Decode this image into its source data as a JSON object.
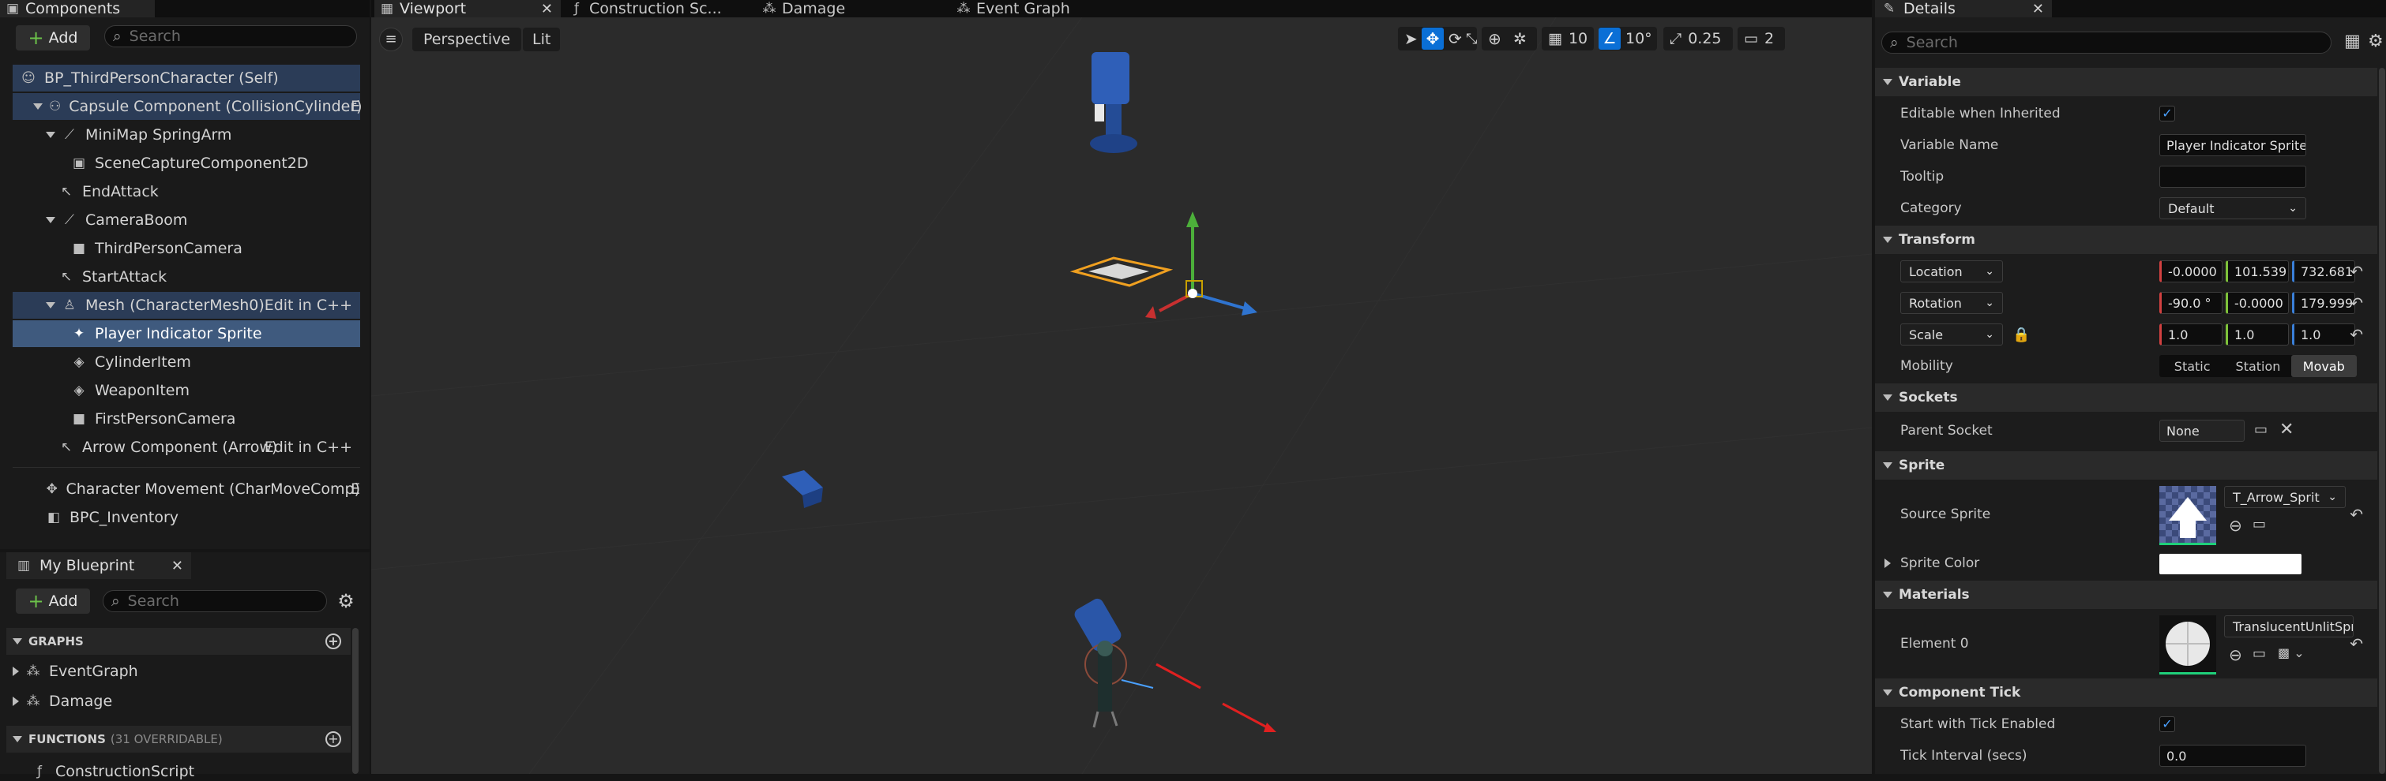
{
  "tabs": {
    "components": "Components",
    "viewport": "Viewport",
    "construction": "Construction Sc...",
    "damage": "Damage",
    "event_graph": "Event Graph",
    "details": "Details"
  },
  "components": {
    "add_label": "Add",
    "search_placeholder": "Search",
    "items": [
      {
        "label": "BP_ThirdPersonCharacter (Self)",
        "icon": "person-icon"
      },
      {
        "label": "Capsule Component (CollisionCylinder)",
        "icon": "capsule-icon",
        "suffix": "E"
      },
      {
        "label": "MiniMap SpringArm",
        "icon": "springarm-icon"
      },
      {
        "label": "SceneCaptureComponent2D",
        "icon": "scene-capture-icon"
      },
      {
        "label": "EndAttack",
        "icon": "arrow-icon"
      },
      {
        "label": "CameraBoom",
        "icon": "springarm-icon"
      },
      {
        "label": "ThirdPersonCamera",
        "icon": "camera-icon"
      },
      {
        "label": "StartAttack",
        "icon": "arrow-icon"
      },
      {
        "label": "Mesh (CharacterMesh0)",
        "icon": "skeletal-mesh-icon",
        "edit": "Edit in C++"
      },
      {
        "label": "Player Indicator Sprite",
        "icon": "sprite-icon"
      },
      {
        "label": "CylinderItem",
        "icon": "static-mesh-icon"
      },
      {
        "label": "WeaponItem",
        "icon": "static-mesh-icon"
      },
      {
        "label": "FirstPersonCamera",
        "icon": "camera-icon"
      },
      {
        "label": "Arrow Component (Arrow)",
        "icon": "arrow-icon",
        "edit": "Edit in C++"
      },
      {
        "label": "Character Movement (CharMoveComp)",
        "icon": "movement-icon",
        "suffix": "E"
      },
      {
        "label": "BPC_Inventory",
        "icon": "actor-component-icon"
      }
    ]
  },
  "my_blueprint": {
    "title": "My Blueprint",
    "add_label": "Add",
    "search_placeholder": "Search",
    "graphs_header": "GRAPHS",
    "graphs": [
      "EventGraph",
      "Damage"
    ],
    "functions_header": "FUNCTIONS",
    "functions_count": "(31 OVERRIDABLE)",
    "functions": [
      "ConstructionScript"
    ]
  },
  "viewport": {
    "perspective": "Perspective",
    "lit": "Lit",
    "grid_snap": "10",
    "rotation_snap": "10°",
    "scale_snap": "0.25",
    "camera_speed": "2"
  },
  "details": {
    "search_placeholder": "Search",
    "sections": {
      "variable": "Variable",
      "transform": "Transform",
      "sockets": "Sockets",
      "sprite": "Sprite",
      "materials": "Materials",
      "component_tick": "Component Tick"
    },
    "variable": {
      "editable_label": "Editable when Inherited",
      "name_label": "Variable Name",
      "name_value": "Player Indicator Sprite",
      "tooltip_label": "Tooltip",
      "tooltip_value": "",
      "category_label": "Category",
      "category_value": "Default"
    },
    "transform": {
      "location_label": "Location",
      "location": [
        "-0.0000",
        "101.539",
        "732.681"
      ],
      "rotation_label": "Rotation",
      "rotation": [
        "-90.0 °",
        "-0.0000",
        "179.999"
      ],
      "scale_label": "Scale",
      "scale": [
        "1.0",
        "1.0",
        "1.0"
      ],
      "mobility_label": "Mobility",
      "mobility_options": [
        "Static",
        "Station",
        "Movab"
      ]
    },
    "sockets": {
      "parent_label": "Parent Socket",
      "parent_value": "None"
    },
    "sprite": {
      "source_label": "Source Sprite",
      "source_value": "T_Arrow_Sprit",
      "color_label": "Sprite Color"
    },
    "materials": {
      "element_label": "Element 0",
      "element_value": "TranslucentUnlitSpri"
    },
    "tick": {
      "start_label": "Start with Tick Enabled",
      "interval_label": "Tick Interval (secs)",
      "interval_value": "0.0"
    }
  },
  "colors": {
    "selection": "#3f5a7e",
    "accent_blue": "#0a6fd6",
    "add_green": "#6cc24a"
  }
}
